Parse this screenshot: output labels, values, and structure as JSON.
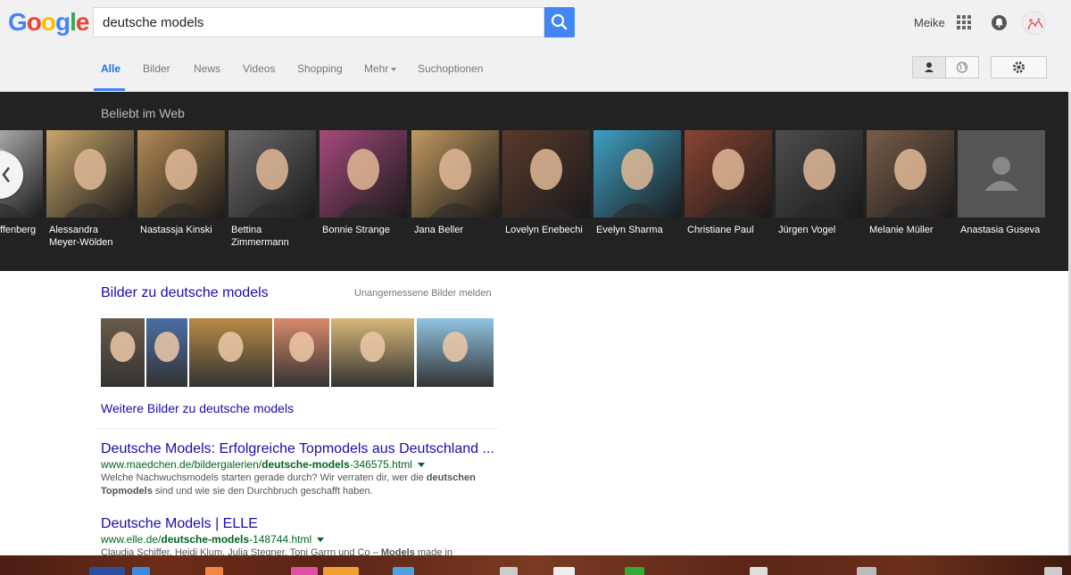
{
  "header": {
    "logo_letters": [
      {
        "ch": "G",
        "color": "#4285f4"
      },
      {
        "ch": "o",
        "color": "#ea4335"
      },
      {
        "ch": "o",
        "color": "#fbbc05"
      },
      {
        "ch": "g",
        "color": "#4285f4"
      },
      {
        "ch": "l",
        "color": "#34a853"
      },
      {
        "ch": "e",
        "color": "#ea4335"
      }
    ],
    "search_value": "deutsche models",
    "user_name": "Meike",
    "icons": {
      "search": "search-icon",
      "apps": "apps-grid-icon",
      "notifications": "notifications-icon",
      "account": "avatar"
    }
  },
  "tabs": [
    {
      "label": "Alle",
      "active": true
    },
    {
      "label": "Bilder"
    },
    {
      "label": "News"
    },
    {
      "label": "Videos"
    },
    {
      "label": "Shopping"
    },
    {
      "label": "Mehr"
    },
    {
      "label": "Suchoptionen"
    }
  ],
  "popular": {
    "title": "Beliebt im Web",
    "items": [
      {
        "name": "ffenberg",
        "line2": "",
        "tone": "#d8d8d8"
      },
      {
        "name": "Alessandra",
        "line2": "Meyer-Wölden",
        "tone": "#c9a66b"
      },
      {
        "name": "Nastassja Kinski",
        "line2": "",
        "tone": "#b58b55"
      },
      {
        "name": "Bettina",
        "line2": "Zimmermann",
        "tone": "#6d6a6a"
      },
      {
        "name": "Bonnie Strange",
        "line2": "",
        "tone": "#a64a7c"
      },
      {
        "name": "Jana Beller",
        "line2": "",
        "tone": "#c29a5f"
      },
      {
        "name": "Lovelyn Enebechi",
        "line2": "",
        "tone": "#5a3a2c"
      },
      {
        "name": "Evelyn Sharma",
        "line2": "",
        "tone": "#3fa0c4"
      },
      {
        "name": "Christiane Paul",
        "line2": "",
        "tone": "#8a4432"
      },
      {
        "name": "Jürgen Vogel",
        "line2": "",
        "tone": "#4d4d4d"
      },
      {
        "name": "Melanie Müller",
        "line2": "",
        "tone": "#7a5d4a"
      },
      {
        "name": "Anastasia Guseva",
        "line2": "",
        "tone": "#555555"
      }
    ]
  },
  "images": {
    "heading": "Bilder zu deutsche models",
    "report": "Unangemessene Bilder melden",
    "more": "Weitere Bilder zu deutsche models",
    "thumbs": [
      {
        "tone": "#6a5a4a"
      },
      {
        "tone": "#4a6fa5"
      },
      {
        "tone": "#b88a44"
      },
      {
        "tone": "#d88a6a"
      },
      {
        "tone": "#d8b878"
      },
      {
        "tone": "#8fc4e2"
      }
    ]
  },
  "results": [
    {
      "title": "Deutsche Models: Erfolgreiche Topmodels aus Deutschland ...",
      "url_prefix": "www.maedchen.de/bildergalerien/",
      "url_bold": "deutsche-models",
      "url_suffix": "-346575.html",
      "snippet1_a": "Welche Nachwuchsmodels starten gerade durch? Wir verraten dir, wer die ",
      "snippet1_b": "deutschen",
      "snippet2_a": "Topmodels",
      "snippet2_b": " sind und wie sie den Durchbruch geschafft haben."
    },
    {
      "title": "Deutsche Models | ELLE",
      "url_prefix": "www.elle.de/",
      "url_bold": "deutsche-models",
      "url_suffix": "-148744.html",
      "snippet1_a": "Claudia Schiffer, Heidi Klum, Julia Stegner, Toni Garrn und Co – ",
      "snippet1_b": "Models",
      "snippet1_c": " made in"
    }
  ],
  "colors": {
    "link": "#1a0dab",
    "url": "#006621",
    "accent": "#4285f4",
    "dark_band": "#222222"
  }
}
